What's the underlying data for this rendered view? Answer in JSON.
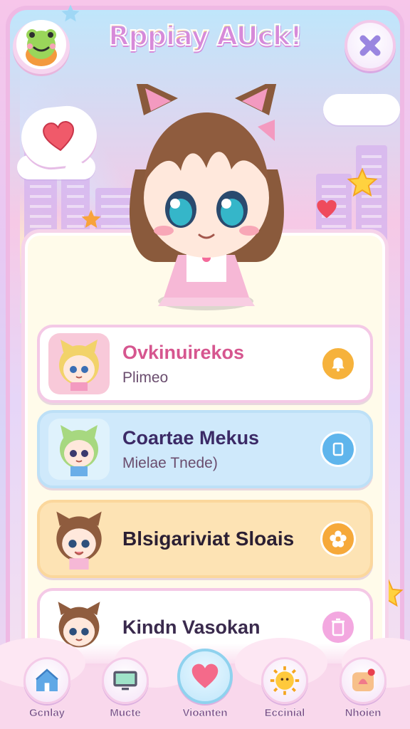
{
  "header": {
    "app_title": "Rppiay AUck!",
    "mascot_icon": "frog-mascot-icon",
    "close_icon": "close-x-icon"
  },
  "hero": {
    "speech_icon": "heart-icon"
  },
  "list": {
    "items": [
      {
        "title": "Ovkinuirekos",
        "subtitle": "Plimeo",
        "title_color": "#d6568f",
        "bg": "#ffffff",
        "action_color": "#f6b23c",
        "action_icon": "bell-icon",
        "avatar": "blonde-cat-girl-avatar"
      },
      {
        "title": "Coartae Mekus",
        "subtitle": "Mielae Tnede)",
        "title_color": "#3b2a66",
        "bg": "#cfe9fb",
        "action_color": "#5fb5ec",
        "action_icon": "copy-icon",
        "avatar": "green-hair-cat-girl-avatar"
      },
      {
        "title": "Blsigariviat Sloais",
        "subtitle": "",
        "title_color": "#2b1f33",
        "bg": "#fde3b4",
        "action_color": "#f6a93a",
        "action_icon": "flower-icon",
        "avatar": "brown-hair-cat-girl-avatar"
      },
      {
        "title": "Kindn Vasokan",
        "subtitle": "",
        "title_color": "#3a2a4d",
        "bg": "#ffffff",
        "action_color": "#f3a8e0",
        "action_icon": "trash-icon",
        "avatar": "brown-cat-girl-avatar"
      }
    ]
  },
  "nav": {
    "items": [
      {
        "label": "Gcnlay",
        "icon": "home-icon"
      },
      {
        "label": "Mucte",
        "icon": "monitor-icon"
      },
      {
        "label": "Vioanten",
        "icon": "heart-icon",
        "active": true
      },
      {
        "label": "Eccinial",
        "icon": "sun-icon"
      },
      {
        "label": "Nhoien",
        "icon": "bell-box-icon"
      }
    ]
  },
  "colors": {
    "accent_pink": "#f4a6d0",
    "accent_blue": "#8fd2ee",
    "panel_bg": "#fffbea"
  }
}
